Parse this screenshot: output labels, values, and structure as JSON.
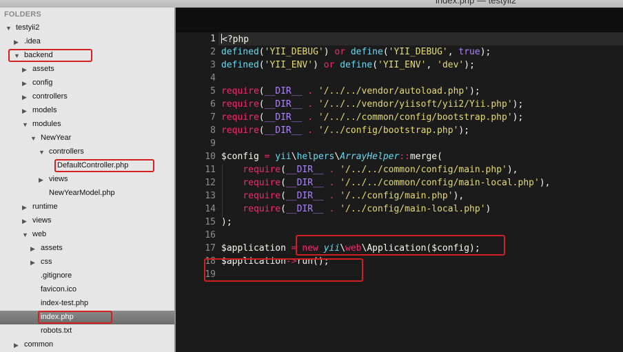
{
  "window": {
    "title": "index.php — testyii2"
  },
  "sidebar": {
    "header": "FOLDERS",
    "rows": [
      {
        "label": "testyii2",
        "arrow": "▼"
      },
      {
        "label": ".idea",
        "arrow": "▶"
      },
      {
        "label": "backend",
        "arrow": "▼",
        "highlight": true
      },
      {
        "label": "assets",
        "arrow": "▶"
      },
      {
        "label": "config",
        "arrow": "▶"
      },
      {
        "label": "controllers",
        "arrow": "▶"
      },
      {
        "label": "models",
        "arrow": "▶"
      },
      {
        "label": "modules",
        "arrow": "▼"
      },
      {
        "label": "NewYear",
        "arrow": "▼"
      },
      {
        "label": "controllers",
        "arrow": "▼"
      },
      {
        "label": "DefaultController.php",
        "arrow": "",
        "highlight": true
      },
      {
        "label": "views",
        "arrow": "▶"
      },
      {
        "label": "NewYearModel.php",
        "arrow": ""
      },
      {
        "label": "runtime",
        "arrow": "▶"
      },
      {
        "label": "views",
        "arrow": "▶"
      },
      {
        "label": "web",
        "arrow": "▼"
      },
      {
        "label": "assets",
        "arrow": "▶"
      },
      {
        "label": "css",
        "arrow": "▶"
      },
      {
        "label": ".gitignore",
        "arrow": ""
      },
      {
        "label": "favicon.ico",
        "arrow": ""
      },
      {
        "label": "index-test.php",
        "arrow": ""
      },
      {
        "label": "index.php",
        "arrow": "",
        "highlight": true,
        "selected": true
      },
      {
        "label": "robots.txt",
        "arrow": ""
      },
      {
        "label": "common",
        "arrow": "▶"
      }
    ]
  },
  "editor": {
    "current_line": 1,
    "lines": [
      [
        [
          "<?php",
          "plain"
        ]
      ],
      [
        [
          "defined",
          "fn"
        ],
        [
          "(",
          "plain"
        ],
        [
          "'YII_DEBUG'",
          "str"
        ],
        [
          ") ",
          "plain"
        ],
        [
          "or",
          "kw"
        ],
        [
          " ",
          "plain"
        ],
        [
          "define",
          "fn"
        ],
        [
          "(",
          "plain"
        ],
        [
          "'YII_DEBUG'",
          "str"
        ],
        [
          ", ",
          "plain"
        ],
        [
          "true",
          "const"
        ],
        [
          ");",
          "plain"
        ]
      ],
      [
        [
          "defined",
          "fn"
        ],
        [
          "(",
          "plain"
        ],
        [
          "'YII_ENV'",
          "str"
        ],
        [
          ") ",
          "plain"
        ],
        [
          "or",
          "kw"
        ],
        [
          " ",
          "plain"
        ],
        [
          "define",
          "fn"
        ],
        [
          "(",
          "plain"
        ],
        [
          "'YII_ENV'",
          "str"
        ],
        [
          ", ",
          "plain"
        ],
        [
          "'dev'",
          "str"
        ],
        [
          ");",
          "plain"
        ]
      ],
      [],
      [
        [
          "require",
          "kw"
        ],
        [
          "(",
          "plain"
        ],
        [
          "__DIR__",
          "const"
        ],
        [
          " ",
          "plain"
        ],
        [
          ".",
          "kw"
        ],
        [
          " ",
          "plain"
        ],
        [
          "'/../../vendor/autoload.php'",
          "str"
        ],
        [
          ");",
          "plain"
        ]
      ],
      [
        [
          "require",
          "kw"
        ],
        [
          "(",
          "plain"
        ],
        [
          "__DIR__",
          "const"
        ],
        [
          " ",
          "plain"
        ],
        [
          ".",
          "kw"
        ],
        [
          " ",
          "plain"
        ],
        [
          "'/../../vendor/yiisoft/yii2/Yii.php'",
          "str"
        ],
        [
          ");",
          "plain"
        ]
      ],
      [
        [
          "require",
          "kw"
        ],
        [
          "(",
          "plain"
        ],
        [
          "__DIR__",
          "const"
        ],
        [
          " ",
          "plain"
        ],
        [
          ".",
          "kw"
        ],
        [
          " ",
          "plain"
        ],
        [
          "'/../../common/config/bootstrap.php'",
          "str"
        ],
        [
          ");",
          "plain"
        ]
      ],
      [
        [
          "require",
          "kw"
        ],
        [
          "(",
          "plain"
        ],
        [
          "__DIR__",
          "const"
        ],
        [
          " ",
          "plain"
        ],
        [
          ".",
          "kw"
        ],
        [
          " ",
          "plain"
        ],
        [
          "'/../config/bootstrap.php'",
          "str"
        ],
        [
          ");",
          "plain"
        ]
      ],
      [],
      [
        [
          "$config",
          "plain"
        ],
        [
          " ",
          "plain"
        ],
        [
          "=",
          "kw"
        ],
        [
          " ",
          "plain"
        ],
        [
          "yii",
          "fn"
        ],
        [
          "\\",
          "plain"
        ],
        [
          "helpers",
          "fn"
        ],
        [
          "\\",
          "plain"
        ],
        [
          "ArrayHelper",
          "ital"
        ],
        [
          "::",
          "kw"
        ],
        [
          "merge(",
          "plain"
        ]
      ],
      [
        [
          "    ",
          "plain"
        ],
        [
          "require",
          "kw"
        ],
        [
          "(",
          "plain"
        ],
        [
          "__DIR__",
          "const"
        ],
        [
          " ",
          "plain"
        ],
        [
          ".",
          "kw"
        ],
        [
          " ",
          "plain"
        ],
        [
          "'/../../common/config/main.php'",
          "str"
        ],
        [
          "),",
          "plain"
        ]
      ],
      [
        [
          "    ",
          "plain"
        ],
        [
          "require",
          "kw"
        ],
        [
          "(",
          "plain"
        ],
        [
          "__DIR__",
          "const"
        ],
        [
          " ",
          "plain"
        ],
        [
          ".",
          "kw"
        ],
        [
          " ",
          "plain"
        ],
        [
          "'/../../common/config/main-local.php'",
          "str"
        ],
        [
          "),",
          "plain"
        ]
      ],
      [
        [
          "    ",
          "plain"
        ],
        [
          "require",
          "kw"
        ],
        [
          "(",
          "plain"
        ],
        [
          "__DIR__",
          "const"
        ],
        [
          " ",
          "plain"
        ],
        [
          ".",
          "kw"
        ],
        [
          " ",
          "plain"
        ],
        [
          "'/../config/main.php'",
          "str"
        ],
        [
          "),",
          "plain"
        ]
      ],
      [
        [
          "    ",
          "plain"
        ],
        [
          "require",
          "kw"
        ],
        [
          "(",
          "plain"
        ],
        [
          "__DIR__",
          "const"
        ],
        [
          " ",
          "plain"
        ],
        [
          ".",
          "kw"
        ],
        [
          " ",
          "plain"
        ],
        [
          "'/../config/main-local.php'",
          "str"
        ],
        [
          ")",
          "plain"
        ]
      ],
      [
        [
          ");",
          "plain"
        ]
      ],
      [],
      [
        [
          "$application",
          "plain"
        ],
        [
          " ",
          "plain"
        ],
        [
          "=",
          "kw"
        ],
        [
          " ",
          "plain"
        ],
        [
          "new",
          "kw"
        ],
        [
          " ",
          "plain"
        ],
        [
          "yii",
          "ital"
        ],
        [
          "\\",
          "plain"
        ],
        [
          "web",
          "kw"
        ],
        [
          "\\",
          "plain"
        ],
        [
          "Application($config);",
          "plain"
        ]
      ],
      [
        [
          "$application",
          "plain"
        ],
        [
          "->",
          "kw"
        ],
        [
          "run();",
          "plain"
        ]
      ],
      []
    ]
  }
}
